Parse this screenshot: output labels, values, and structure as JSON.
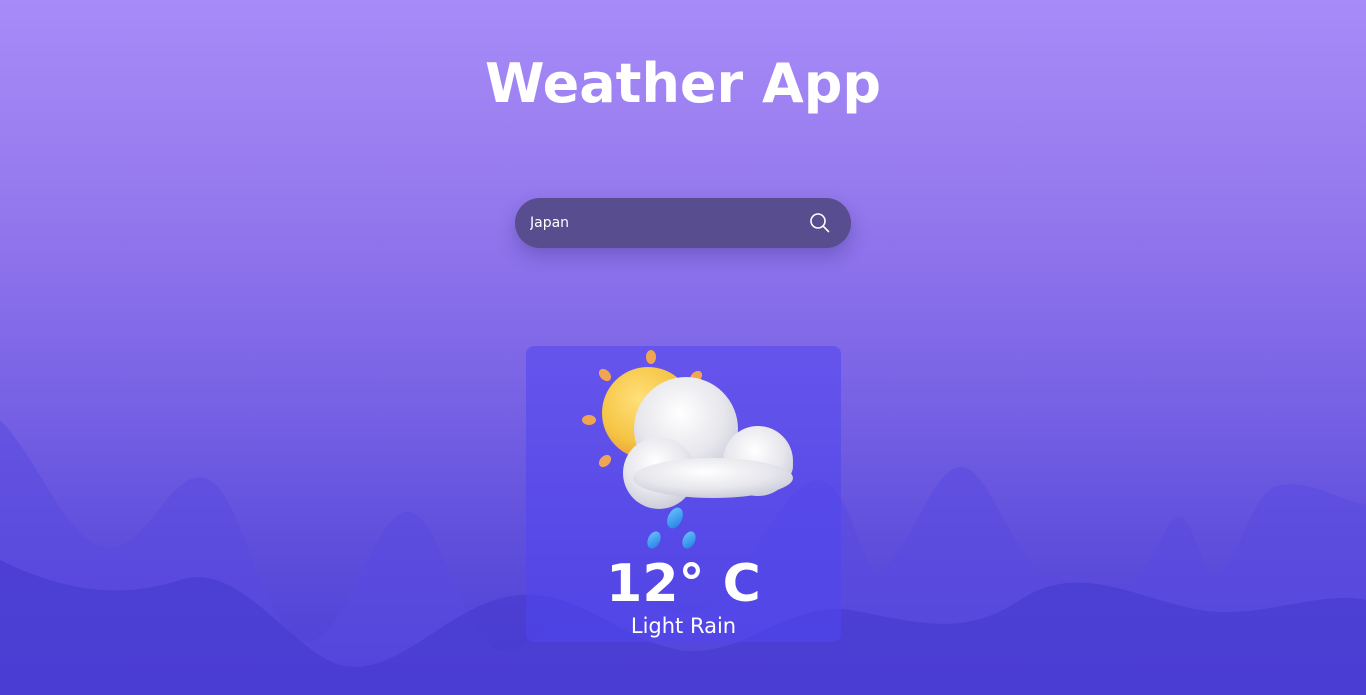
{
  "header": {
    "title": "Weather App"
  },
  "search": {
    "value": "Japan",
    "placeholder": "",
    "button_icon": "search-icon"
  },
  "weather": {
    "icon": "sun-cloud-rain-icon",
    "temperature": "12° C",
    "condition": "Light Rain"
  },
  "colors": {
    "background_top": "#a78bf8",
    "background_bottom": "#4a3fd4",
    "search_bar": "#584d8e",
    "card": "#5046f0",
    "text": "#ffffff"
  }
}
